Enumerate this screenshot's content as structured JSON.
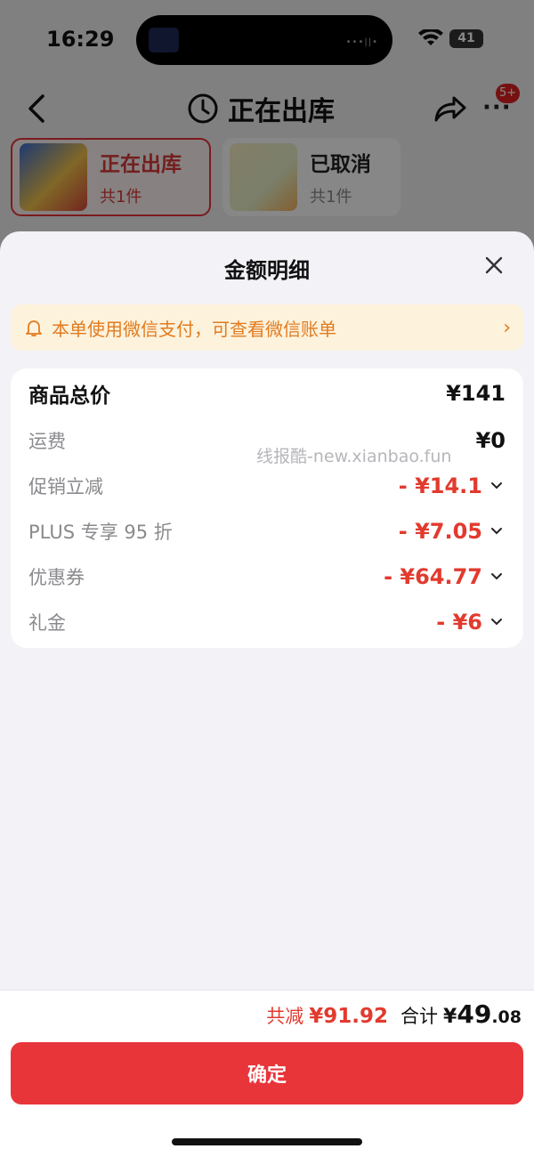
{
  "status_bar": {
    "time": "16:29",
    "battery": "41"
  },
  "nav": {
    "title": "正在出库",
    "badge": "5+"
  },
  "order_tabs": [
    {
      "title": "正在出库",
      "count": "共1件"
    },
    {
      "title": "已取消",
      "count": "共1件"
    }
  ],
  "sheet": {
    "title": "金额明细",
    "notice": "本单使用微信支付，可查看微信账单",
    "rows": [
      {
        "label": "商品总价",
        "value": "¥141"
      },
      {
        "label": "运费",
        "value": "¥0"
      },
      {
        "label": "促销立减",
        "value": "- ¥14.1"
      },
      {
        "label": "PLUS 专享 95 折",
        "value": "- ¥7.05"
      },
      {
        "label": "优惠券",
        "value": "- ¥64.77"
      },
      {
        "label": "礼金",
        "value": "- ¥6"
      }
    ],
    "watermark": "线报酷-new.xianbao.fun"
  },
  "footer": {
    "saved_label": "共减",
    "saved_value": "¥91.92",
    "total_label": "合计",
    "total_symbol": "¥",
    "total_int": "49",
    "total_dec": ".08",
    "confirm_label": "确定"
  },
  "colors": {
    "accent_red": "#e8353a",
    "notice_orange": "#e27b1f",
    "notice_bg": "#fdf2dc"
  }
}
